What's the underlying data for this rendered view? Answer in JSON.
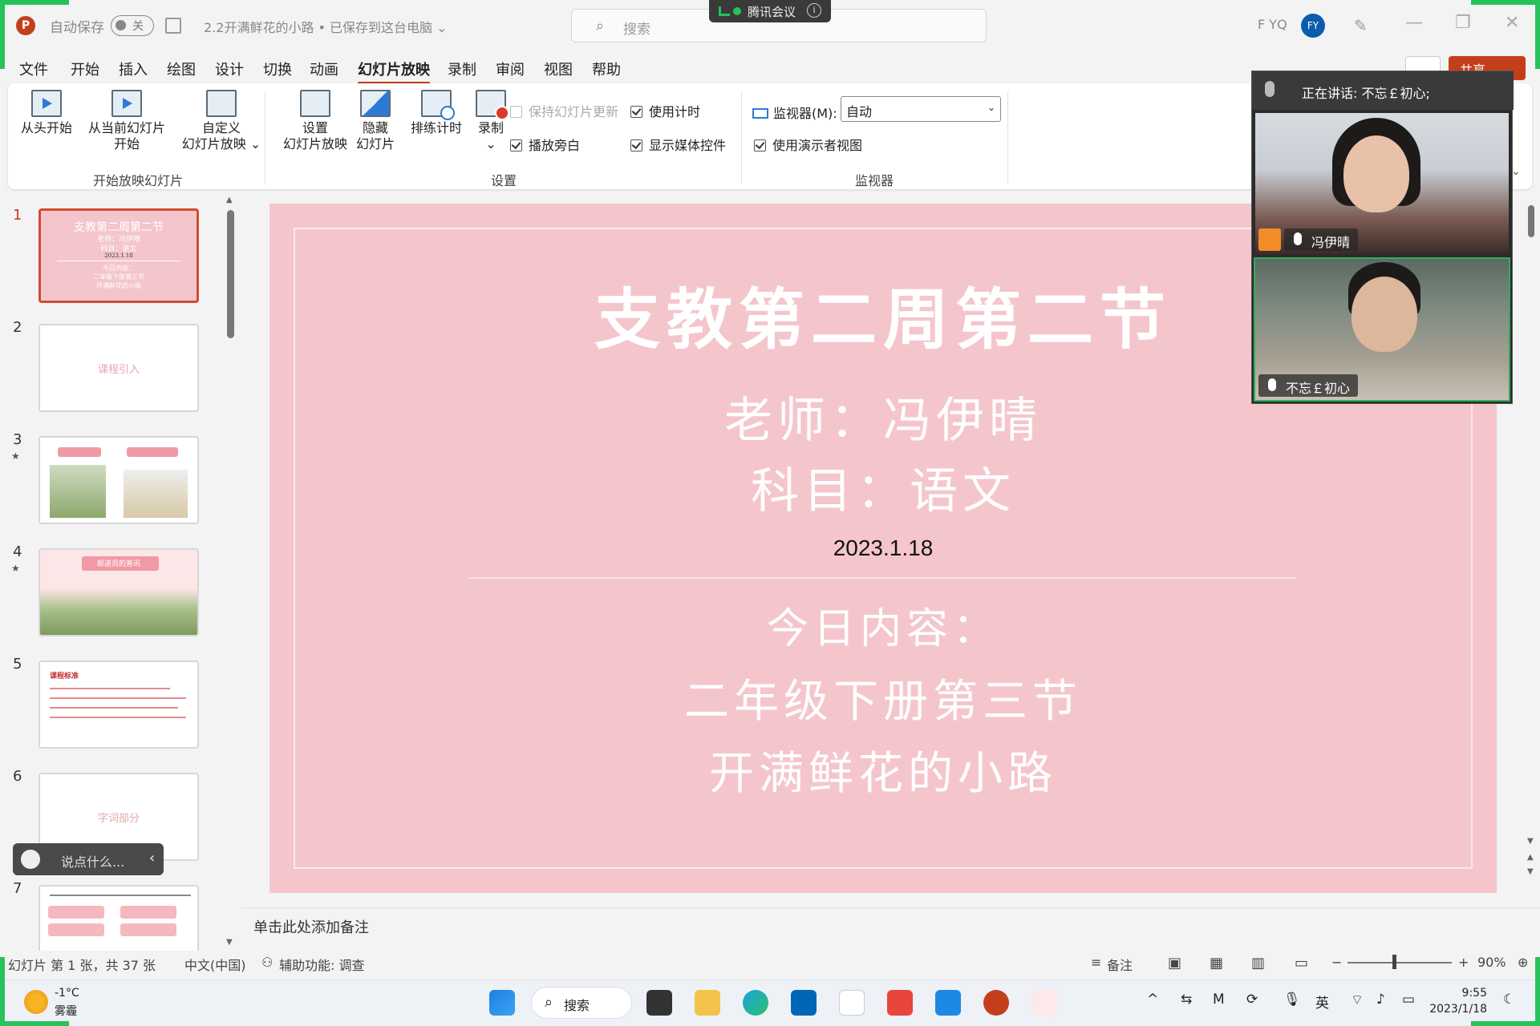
{
  "titlebar": {
    "app_logo": "P",
    "autosave_label": "自动保存",
    "autosave_state": "关",
    "doc_title": "2.2开满鲜花的小路 • 已保存到这台电脑 ⌄",
    "search_placeholder": "搜索",
    "meeting_app": "腾讯会议",
    "user_initials": "F YQ",
    "user_avatar": "FY"
  },
  "tabs": [
    "文件",
    "开始",
    "插入",
    "绘图",
    "设计",
    "切换",
    "动画",
    "幻灯片放映",
    "录制",
    "审阅",
    "视图",
    "帮助"
  ],
  "share_label": "共享",
  "ribbon": {
    "start_group": {
      "from_start_l1": "从头开始",
      "from_current_l1": "从当前幻灯片",
      "from_current_l2": "开始",
      "custom_l1": "自定义",
      "custom_l2": "幻灯片放映 ⌄",
      "label": "开始放映幻灯片"
    },
    "setup_group": {
      "setup_l1": "设置",
      "setup_l2": "幻灯片放映",
      "hide_l1": "隐藏",
      "hide_l2": "幻灯片",
      "rehearse": "排练计时",
      "record_l1": "录制",
      "record_l2": "⌄",
      "keep_updated": "保持幻灯片更新",
      "use_timings": "使用计时",
      "play_narration": "播放旁白",
      "show_media": "显示媒体控件",
      "label": "设置"
    },
    "monitor_group": {
      "monitor_label": "监视器(M):",
      "monitor_value": "自动",
      "presenter_view": "使用演示者视图",
      "label": "监视器"
    }
  },
  "thumbnails": {
    "numbers": [
      "1",
      "2",
      "3",
      "4",
      "5",
      "6",
      "7"
    ],
    "t1_title": "支教第二周第二节",
    "t1_l1": "老师：冯伊晴",
    "t1_l2": "科目：语文",
    "t1_l3": "2023.1.18",
    "t1_l4": "今日内容：",
    "t1_l5": "二年级下册第三节",
    "t1_l6": "开满鲜花的小路",
    "t2_label": "课程引入",
    "t4_label": "邮递员的喜讯",
    "t5_title": "课程标准",
    "t6_label": "字词部分"
  },
  "chat_placeholder": "说点什么...",
  "slide": {
    "title": "支教第二周第二节",
    "teacher": "老师：冯伊晴",
    "subject": "科目：语文",
    "date": "2023.1.18",
    "today": "今日内容：",
    "lesson1": "二年级下册第三节",
    "lesson2": "开满鲜花的小路"
  },
  "notes_placeholder": "单击此处添加备注",
  "statusbar": {
    "slide_count": "幻灯片 第 1 张，共 37 张",
    "language": "中文(中国)",
    "accessibility": "辅助功能: 调查",
    "notes": "备注",
    "zoom": "90%"
  },
  "meeting": {
    "speaking": "正在讲话: 不忘￡初心;",
    "participant1": "冯伊晴",
    "participant2": "不忘￡初心"
  },
  "taskbar": {
    "temperature": "-1°C",
    "weather": "雾霾",
    "search": "搜索",
    "ime": "英",
    "time": "9:55",
    "date": "2023/1/18"
  },
  "colors": {
    "accent": "#c43e1c",
    "slide_bg": "#f4c6cc",
    "meeting_green": "#27c25c"
  }
}
